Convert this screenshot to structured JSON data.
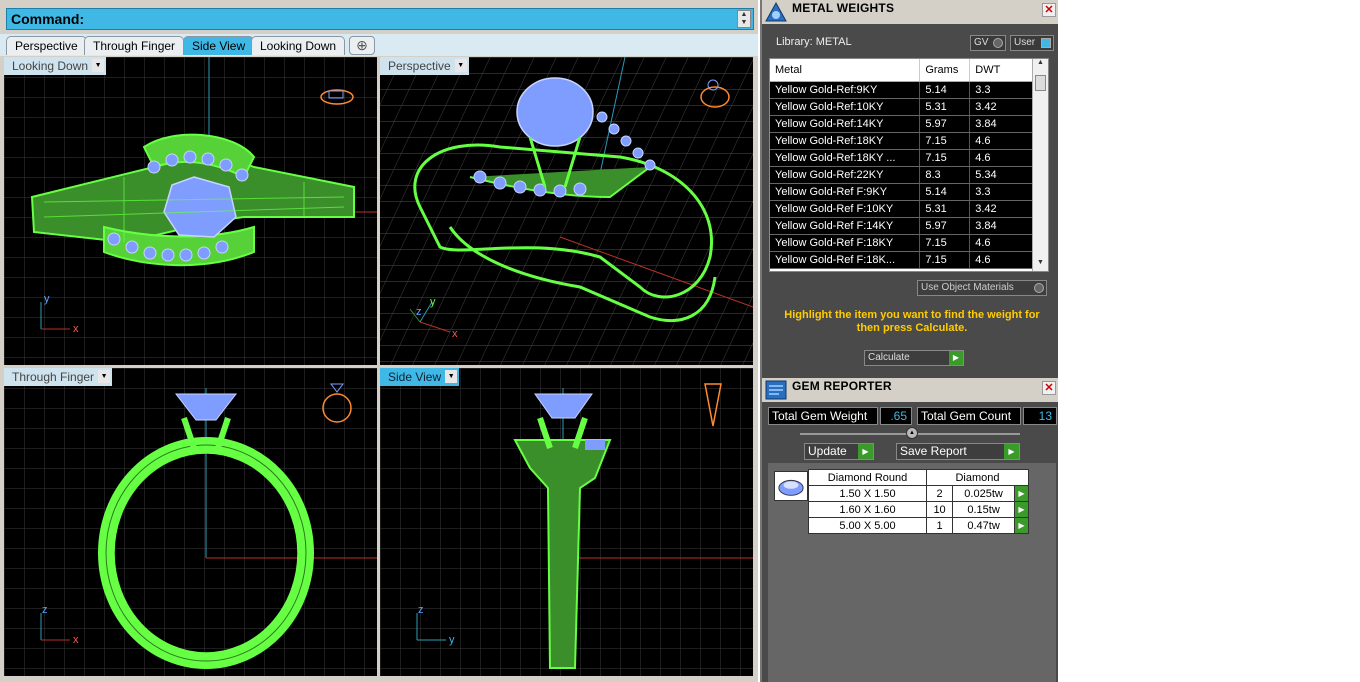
{
  "command_bar": {
    "label": "Command:"
  },
  "view_tabs": [
    {
      "label": "Perspective",
      "active": false
    },
    {
      "label": "Through Finger",
      "active": false
    },
    {
      "label": "Side View",
      "active": true
    },
    {
      "label": "Looking Down",
      "active": false
    }
  ],
  "viewports": {
    "looking_down": {
      "label": "Looking Down",
      "axis1": "y",
      "axis2": "x"
    },
    "perspective": {
      "label": "Perspective",
      "axis1": "z",
      "axis2": "x",
      "axis3": "y"
    },
    "through_finger": {
      "label": "Through Finger",
      "axis1": "z",
      "axis2": "x"
    },
    "side_view": {
      "label": "Side View",
      "axis1": "z",
      "axis2": "y"
    }
  },
  "colors": {
    "accent": "#3fb8e6",
    "wire_green": "#66ff44",
    "gem_blue": "#7f9cff",
    "panel_bg": "#4a4a4a",
    "yellow_text": "#ffcc00"
  },
  "metal_weights": {
    "title": "METAL WEIGHTS",
    "library_label": "Library: METAL",
    "gv_label": "GV",
    "user_label": "User",
    "columns": [
      "Metal",
      "Grams",
      "DWT"
    ],
    "rows": [
      [
        "Yellow Gold-Ref:9KY",
        "5.14",
        "3.3"
      ],
      [
        "Yellow Gold-Ref:10KY",
        "5.31",
        "3.42"
      ],
      [
        "Yellow Gold-Ref:14KY",
        "5.97",
        "3.84"
      ],
      [
        "Yellow Gold-Ref:18KY",
        "7.15",
        "4.6"
      ],
      [
        "Yellow Gold-Ref:18KY ...",
        "7.15",
        "4.6"
      ],
      [
        "Yellow Gold-Ref:22KY",
        "8.3",
        "5.34"
      ],
      [
        "Yellow Gold-Ref F:9KY",
        "5.14",
        "3.3"
      ],
      [
        "Yellow Gold-Ref F:10KY",
        "5.31",
        "3.42"
      ],
      [
        "Yellow Gold-Ref F:14KY",
        "5.97",
        "3.84"
      ],
      [
        "Yellow Gold-Ref F:18KY",
        "7.15",
        "4.6"
      ],
      [
        "Yellow Gold-Ref F:18K...",
        "7.15",
        "4.6"
      ]
    ],
    "use_object_materials": "Use Object Materials",
    "message": "Highlight the item you want to find the weight for then press Calculate.",
    "calculate_label": "Calculate"
  },
  "gem_reporter": {
    "title": "GEM REPORTER",
    "total_weight_label": "Total Gem Weight",
    "total_weight_value": ".65",
    "total_count_label": "Total Gem Count",
    "total_count_value": "13",
    "update_label": "Update",
    "save_report_label": "Save Report",
    "header_shape": "Diamond Round",
    "header_type": "Diamond",
    "gems": [
      {
        "size": "1.50 X 1.50",
        "count": "2",
        "weight": "0.025tw"
      },
      {
        "size": "1.60 X 1.60",
        "count": "10",
        "weight": "0.15tw"
      },
      {
        "size": "5.00 X 5.00",
        "count": "1",
        "weight": "0.47tw"
      }
    ]
  }
}
